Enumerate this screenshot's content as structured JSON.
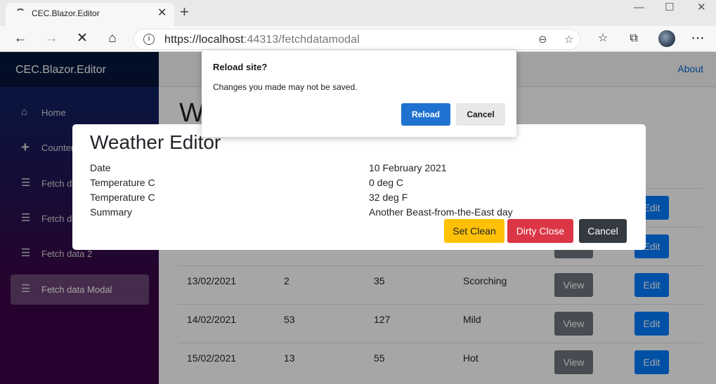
{
  "browser": {
    "tab_title": "CEC.Blazor.Editor",
    "url_host": "https://localhost",
    "url_port_path": ":44313/fetchdatamodal"
  },
  "app": {
    "brand": "CEC.Blazor.Editor",
    "about_link": "About",
    "page_heading": "W",
    "sidebar": [
      {
        "label": "Home",
        "icon": "home-icon"
      },
      {
        "label": "Counter",
        "icon": "plus-icon"
      },
      {
        "label": "Fetch data",
        "icon": "list-icon"
      },
      {
        "label": "Fetch data",
        "icon": "list-icon"
      },
      {
        "label": "Fetch data 2",
        "icon": "list-icon"
      },
      {
        "label": "Fetch data Modal",
        "icon": "list-icon"
      }
    ],
    "row_buttons": {
      "view": "View",
      "edit": "Edit"
    },
    "rows": [
      {
        "date": "13/02/2021",
        "temp_c": "2",
        "temp_f": "35",
        "summary": "Scorching"
      },
      {
        "date": "14/02/2021",
        "temp_c": "53",
        "temp_f": "127",
        "summary": "Mild"
      },
      {
        "date": "15/02/2021",
        "temp_c": "13",
        "temp_f": "55",
        "summary": "Hot"
      }
    ]
  },
  "editor": {
    "title": "Weather Editor",
    "fields": [
      {
        "label": "Date",
        "value": "10 February 2021"
      },
      {
        "label": "Temperature C",
        "value": "0 deg C"
      },
      {
        "label": "Temperature C",
        "value": "32 deg F"
      },
      {
        "label": "Summary",
        "value": "Another Beast-from-the-East day"
      }
    ],
    "buttons": {
      "set_clean": "Set Clean",
      "dirty_close": "Dirty Close",
      "cancel": "Cancel"
    }
  },
  "dialog": {
    "title": "Reload site?",
    "message": "Changes you made may not be saved.",
    "reload": "Reload",
    "cancel": "Cancel"
  }
}
